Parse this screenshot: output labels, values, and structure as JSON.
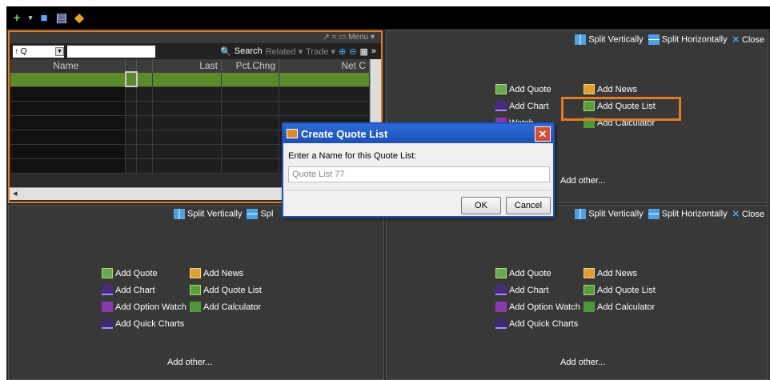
{
  "toolbar": {
    "icons": [
      "add-icon",
      "save-icon",
      "print-icon",
      "workspace-icon"
    ]
  },
  "quote_panel": {
    "header_text": "↗ ≈ ▭ Menu ▾",
    "symbol_prefix": "↑ Q",
    "search_label": "Search",
    "related_label": "Related ▾",
    "trade_label": "Trade ▾",
    "columns": [
      "Name",
      "",
      "",
      "Last",
      "Pct.Chng",
      "Net C"
    ]
  },
  "split": {
    "vertical": "Split Vertically",
    "horizontal": "Split Horizontally",
    "close": "Close"
  },
  "add": {
    "quote": "Add Quote",
    "news": "Add News",
    "chart": "Add Chart",
    "quote_list": "Add Quote List",
    "option_watch": "Add Option Watch",
    "calculator": "Add Calculator",
    "quick_charts": "Add Quick Charts",
    "other": "Add other..."
  },
  "partial": {
    "watch": "Watch",
    "charts": "arts",
    "other": "Add other...",
    "spl": "Spl"
  },
  "dialog": {
    "title": "Create Quote List",
    "prompt": "Enter a Name for this Quote List:",
    "input_value": "Quote List 77",
    "ok": "OK",
    "cancel": "Cancel"
  }
}
